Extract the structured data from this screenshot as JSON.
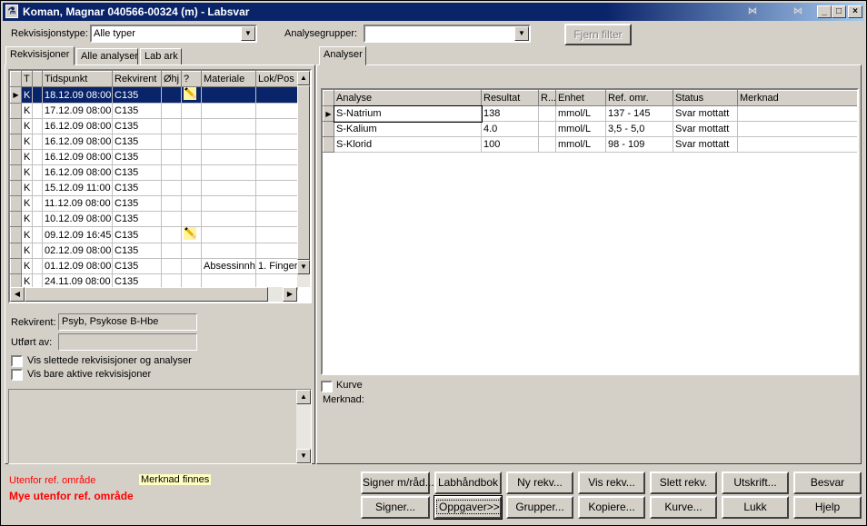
{
  "window": {
    "title": "Koman, Magnar  040566-00324 (m) - Labsvar",
    "icon": "flask-icon",
    "min_label": "_",
    "max_label": "□",
    "close_label": "×"
  },
  "filters": {
    "rekvisisjonstype_label": "Rekvisisjonstype:",
    "rekvisisjonstype_value": "Alle typer",
    "analysegrupper_label": "Analysegrupper:",
    "analysegrupper_value": "",
    "fjern_filter_label": "Fjern filter"
  },
  "left_tabs": [
    "Rekvisisjoner",
    "Alle analyser",
    "Lab ark"
  ],
  "requisitions": {
    "columns": [
      "T",
      "",
      "Tidspunkt",
      "Rekvirent",
      "Øhj",
      "?",
      "Materiale",
      "Lok/Pos"
    ],
    "rows": [
      {
        "t": "K",
        "time": "18.12.09 08:00",
        "rekvirent": "C135",
        "ohj": "",
        "note": true,
        "materiale": "",
        "lok": "",
        "selected": true
      },
      {
        "t": "K",
        "time": "17.12.09 08:00",
        "rekvirent": "C135",
        "ohj": "",
        "note": false,
        "materiale": "",
        "lok": ""
      },
      {
        "t": "K",
        "time": "16.12.09 08:00",
        "rekvirent": "C135",
        "ohj": "",
        "note": false,
        "materiale": "",
        "lok": ""
      },
      {
        "t": "K",
        "time": "16.12.09 08:00",
        "rekvirent": "C135",
        "ohj": "",
        "note": false,
        "materiale": "",
        "lok": ""
      },
      {
        "t": "K",
        "time": "16.12.09 08:00",
        "rekvirent": "C135",
        "ohj": "",
        "note": false,
        "materiale": "",
        "lok": ""
      },
      {
        "t": "K",
        "time": "16.12.09 08:00",
        "rekvirent": "C135",
        "ohj": "",
        "note": false,
        "materiale": "",
        "lok": ""
      },
      {
        "t": "K",
        "time": "15.12.09 11:00",
        "rekvirent": "C135",
        "ohj": "",
        "note": false,
        "materiale": "",
        "lok": ""
      },
      {
        "t": "K",
        "time": "11.12.09 08:00",
        "rekvirent": "C135",
        "ohj": "",
        "note": false,
        "materiale": "",
        "lok": ""
      },
      {
        "t": "K",
        "time": "10.12.09 08:00",
        "rekvirent": "C135",
        "ohj": "",
        "note": false,
        "materiale": "",
        "lok": ""
      },
      {
        "t": "K",
        "time": "09.12.09 16:45",
        "rekvirent": "C135",
        "ohj": "",
        "note": true,
        "materiale": "",
        "lok": ""
      },
      {
        "t": "K",
        "time": "02.12.09 08:00",
        "rekvirent": "C135",
        "ohj": "",
        "note": false,
        "materiale": "",
        "lok": ""
      },
      {
        "t": "K",
        "time": "01.12.09 08:00",
        "rekvirent": "C135",
        "ohj": "",
        "note": false,
        "materiale": "Absessinnhold",
        "lok": "1. Finger"
      },
      {
        "t": "K",
        "time": "24.11.09 08:00",
        "rekvirent": "C135",
        "ohj": "",
        "note": false,
        "materiale": "",
        "lok": ""
      }
    ]
  },
  "details": {
    "rekvirent_label": "Rekvirent:",
    "rekvirent_value": "Psyb, Psykose B-Hbe",
    "utfort_label": "Utført av:",
    "utfort_value": "",
    "vis_slettede_label": "Vis slettede rekvisisjoner og analyser",
    "vis_aktive_label": "Vis bare aktive rekvisisjoner"
  },
  "right_tab": "Analyser",
  "analyses": {
    "columns": [
      "Analyse",
      "Resultat",
      "R...",
      "Enhet",
      "Ref. omr.",
      "Status",
      "Merknad"
    ],
    "rows": [
      {
        "analyse": "S-Natrium",
        "resultat": "138",
        "r": "",
        "enhet": "mmol/L",
        "ref": "137 - 145",
        "status": "Svar mottatt",
        "merknad": "",
        "current": true
      },
      {
        "analyse": "S-Kalium",
        "resultat": "4.0",
        "r": "",
        "enhet": "mmol/L",
        "ref": "3,5 - 5,0",
        "status": "Svar mottatt",
        "merknad": ""
      },
      {
        "analyse": "S-Klorid",
        "resultat": "100",
        "r": "",
        "enhet": "mmol/L",
        "ref": "98 - 109",
        "status": "Svar mottatt",
        "merknad": ""
      }
    ]
  },
  "kurve_label": "Kurve",
  "merknad_label": "Merknad:",
  "legend": {
    "utenfor": "Utenfor ref. område",
    "merknad_finnes": "Merknad finnes",
    "mye_utenfor": "Mye utenfor ref. område",
    "red_color": "#ff0000",
    "note_color": "#ffffc0"
  },
  "buttons": {
    "signer_med_rad": "Signer m/råd...",
    "labhandbok": "Labhåndbok",
    "ny_rekv": "Ny rekv...",
    "vis_rekv": "Vis rekv...",
    "slett_rekv": "Slett rekv.",
    "utskrift": "Utskrift...",
    "besvar": "Besvar",
    "signer": "Signer...",
    "oppgaver": "Oppgaver>>",
    "grupper": "Grupper...",
    "kopiere": "Kopiere...",
    "kurve": "Kurve...",
    "lukk": "Lukk",
    "hjelp": "Hjelp"
  }
}
